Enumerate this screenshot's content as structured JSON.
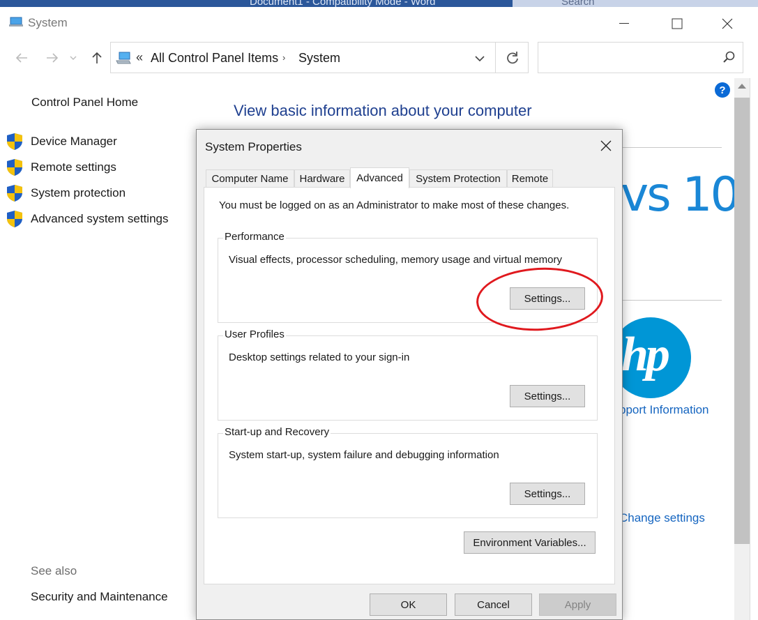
{
  "word_ribbon": {
    "doc_title": "Document1 - Compatibility Mode - Word",
    "search_label": "Search"
  },
  "window": {
    "title": "System"
  },
  "address_bar": {
    "overflow": "«",
    "crumbs": [
      "All Control Panel Items",
      "System"
    ],
    "separator": "›"
  },
  "search": {
    "placeholder": ""
  },
  "left_nav": {
    "home": "Control Panel Home",
    "items": [
      {
        "label": "Device Manager"
      },
      {
        "label": "Remote settings"
      },
      {
        "label": "System protection"
      },
      {
        "label": "Advanced system settings"
      }
    ],
    "see_also": "See also",
    "see_also_items": [
      "Security and Maintenance"
    ]
  },
  "main": {
    "heading": "View basic information about your computer",
    "windows_brand_fragment": "vs 10",
    "oem_logo_text": "hp",
    "support_link_fragment": "pport Information",
    "change_settings_fragment": "Change settings",
    "help_label": "?"
  },
  "dialog": {
    "title": "System Properties",
    "tabs": [
      {
        "label": "Computer Name",
        "active": false
      },
      {
        "label": "Hardware",
        "active": false
      },
      {
        "label": "Advanced",
        "active": true
      },
      {
        "label": "System Protection",
        "active": false
      },
      {
        "label": "Remote",
        "active": false
      }
    ],
    "admin_message": "You must be logged on as an Administrator to make most of these changes.",
    "groups": [
      {
        "label": "Performance",
        "description": "Visual effects, processor scheduling, memory usage and virtual memory",
        "button": "Settings...",
        "highlighted": true
      },
      {
        "label": "User Profiles",
        "description": "Desktop settings related to your sign-in",
        "button": "Settings..."
      },
      {
        "label": "Start-up and Recovery",
        "description": "System start-up, system failure and debugging information",
        "button": "Settings..."
      }
    ],
    "env_button": "Environment Variables...",
    "buttons": {
      "ok": "OK",
      "cancel": "Cancel",
      "apply": "Apply"
    }
  },
  "colors": {
    "accent_link": "#1565c0",
    "heading": "#1e3f8f",
    "annotation_oval": "#e0191e",
    "word_blue": "#2b579a"
  }
}
